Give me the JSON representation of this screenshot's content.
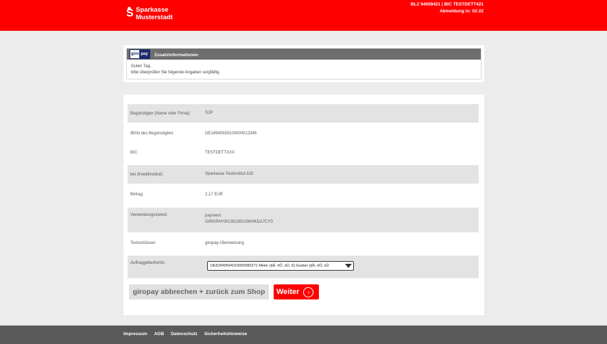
{
  "header": {
    "bank_name_line1": "Sparkasse",
    "bank_name_line2": "Musterstadt",
    "bank_codes": "BLZ 94059421 | BIC TESTDETT421",
    "logout_timer": "Abmeldung in: 02:22",
    "brand_color": "#ff0000"
  },
  "info": {
    "logo_giro": "giro",
    "logo_pay": "pay",
    "title": "Zusatzinformationen",
    "line1": "Guten Tag,",
    "line2": "bitte überprüfen Sie folgende Angaben sorgfältig."
  },
  "form": {
    "rows": [
      {
        "label": "Begünstigter (Name oder Firma):",
        "value": "S2P"
      },
      {
        "label": "IBAN des Begünstigten:",
        "value": "DE14940593100000012346"
      },
      {
        "label": "BIC:",
        "value": "TESTDETTXXX"
      },
      {
        "label": "bei (Kreditinstitut):",
        "value": "Sparkasse Testinstitut-310"
      },
      {
        "label": "Betrag:",
        "value": "2,17 EUR"
      },
      {
        "label": "Verwendungszweck:",
        "value": "payment",
        "value2": "GIROPAY00135100015KHKDA7CY3"
      },
      {
        "label": "Textschlüssel:",
        "value": "giropay-Überweisung"
      },
      {
        "label": "Auftraggeberkonto:",
        "value": "DE52940594210000082271 Meier (äÄ, öÖ, üÜ, ß) Gustav (äÄ, öÖ, üÜ"
      }
    ]
  },
  "buttons": {
    "cancel_label": "giropay abbrechen + zurück zum Shop",
    "next_label": "Weiter",
    "next_icon": "arrow-right-circle-icon"
  },
  "footer": {
    "links": [
      "Impressum",
      "AGB",
      "Datenschutz",
      "Sicherheitshinweise"
    ]
  }
}
